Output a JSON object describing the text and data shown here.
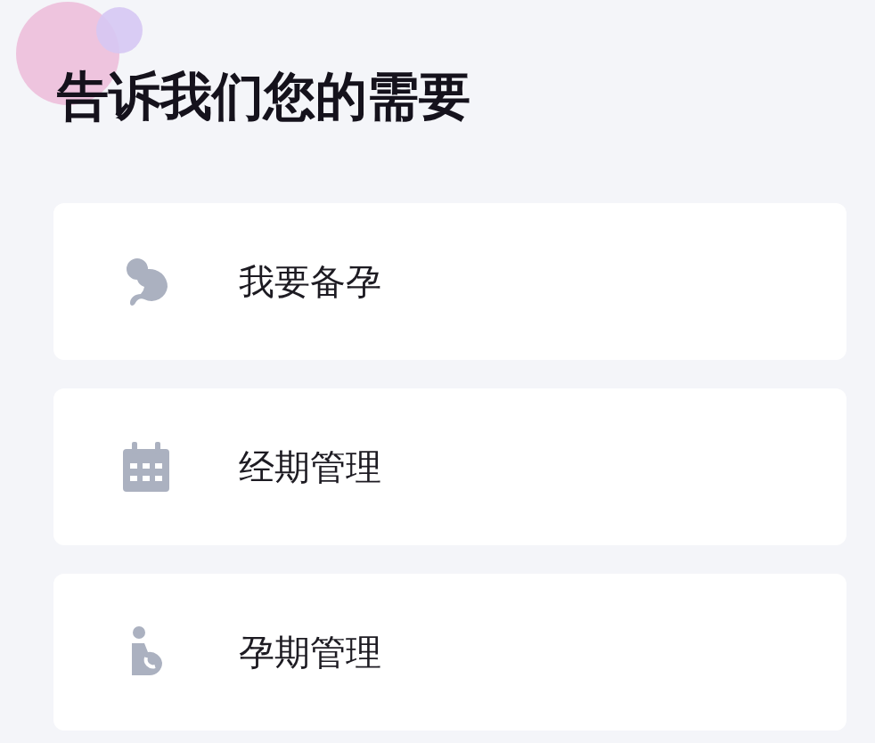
{
  "title": "告诉我们您的需要",
  "options": [
    {
      "kind": "fertility",
      "label": "我要备孕"
    },
    {
      "kind": "period",
      "label": "经期管理"
    },
    {
      "kind": "pregnancy",
      "label": "孕期管理"
    }
  ]
}
